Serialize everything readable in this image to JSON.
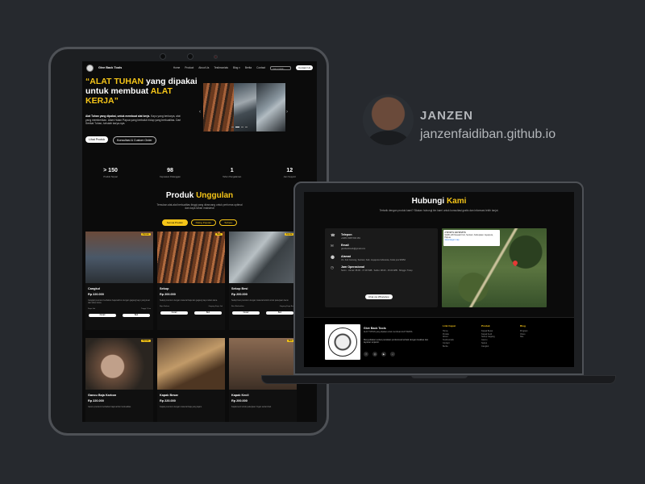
{
  "person": {
    "name": "JANZEN",
    "site": "janzenfaidiban.github.io"
  },
  "tablet": {
    "nav": {
      "brand": "Give Back Tools",
      "links": [
        "Home",
        "Product",
        "About Us",
        "Testimonials",
        "Blog ▾",
        "Berita",
        "Contact"
      ],
      "search_placeholder": "Cari produk...",
      "cta": "Contact Us"
    },
    "hero": {
      "q_open": "“",
      "w1": "ALAT TUHAN",
      "w2": " yang dipakai untuk membuat ",
      "w3": "ALAT KERJA",
      "q_close": "”",
      "desc_bold": "Alat Tuhan yang dipakai, untuk membuat alat kerja.",
      "desc_rest": " Kayu yang berkarya, alat yang memberikan. Alam Hutan Papua yang berbalut hidup yang berkualitas. Dari Seekat Tuhan, tahulah karya-nya.",
      "btn_primary": "Lihat Produk",
      "btn_secondary": "Konsultasi & Custom Order"
    },
    "stats": [
      {
        "value": "> 150",
        "label": "Produk Terjual"
      },
      {
        "value": "98",
        "label": "Kepuasan Pelanggan"
      },
      {
        "value": "1",
        "label": "Tahun Pengalaman"
      },
      {
        "value": "12",
        "label": "Jam Support"
      }
    ],
    "products_section": {
      "title_a": "Produk ",
      "title_b": "Unggulan",
      "subtitle": "Temukan alat-alat berkualitas tinggi yang dirancang untuk performa optimal dan daya tahan maksimal",
      "filters": [
        "Semua Produk",
        "Paling Populer",
        "Terbaru"
      ]
    },
    "products": [
      {
        "name": "Cangkul",
        "price": "Rp 220.000",
        "tag": "Populer",
        "desc": "Cangkul premium berbahan baja karbon dengan gagang kayu yang kuat dan tahan lama.",
        "spec_a": "Kayu Jati",
        "spec_b": "Tinggi 1,5 m",
        "btn_a": "Detail",
        "btn_b": "Beli"
      },
      {
        "name": "Sekop",
        "price": "Rp 200.000",
        "tag": "Baru",
        "desc": "Sekop premium dengan material baja dan gagang kayu tahan lama.",
        "spec_a": "Baja Karbon",
        "spec_b": "Gagang Kayu Jati",
        "btn_a": "Detail",
        "btn_b": "Beli"
      },
      {
        "name": "Sekop Besi",
        "price": "Rp 200.000",
        "tag": "Populer",
        "desc": "Sekop besi premium dengan material kokoh untuk pekerjaan berat.",
        "spec_a": "Besi Berkualitas",
        "spec_b": "Gagang Kayu Besi",
        "btn_a": "Detail",
        "btn_b": "Beli"
      },
      {
        "name": "Gancu Baja Karbon",
        "price": "Rp 220.000",
        "tag": "Populer",
        "desc": "Gancu premium berbahan baja karbon berkualitas.",
        "spec_a": "",
        "spec_b": "",
        "btn_a": "",
        "btn_b": ""
      },
      {
        "name": "Kapak Besar",
        "price": "Rp 220.000",
        "tag": "",
        "desc": "Kapak premium dengan material baja yang tajam.",
        "spec_a": "",
        "spec_b": "",
        "btn_a": "",
        "btn_b": ""
      },
      {
        "name": "Kapak Kecil",
        "price": "Rp 200.000",
        "tag": "Baru",
        "desc": "Kapak kecil untuk pekerjaan ringan sehari-hari.",
        "spec_a": "",
        "spec_b": "",
        "btn_a": "",
        "btn_b": ""
      }
    ]
  },
  "laptop": {
    "contact": {
      "title_a": "Hubungi ",
      "title_b": "Kami",
      "subtitle": "Tertarik dengan produk kami? Silakan hubungi tim kami untuk konsultasi gratis dan informasi lebih lanjut.",
      "items": [
        {
          "icon": "phone-icon",
          "glyph": "☎",
          "label": "Telepon",
          "value": "+6281 0305 549 181"
        },
        {
          "icon": "mail-icon",
          "glyph": "✉",
          "label": "Email",
          "value": "givebacktools@gmail.com"
        },
        {
          "icon": "location-icon",
          "glyph": "⬤",
          "label": "Alamat",
          "value": "Jln. Koti Gunung, Sentani, Kab. Jayapura Indonesia, Kode pos 99352"
        },
        {
          "icon": "clock-icon",
          "glyph": "◷",
          "label": "Jam Operasional",
          "value": "Senin - Jumat: 08.00 - 17.00 WIB · Sabtu: 08.00 - 15.00 WIB · Minggu: Tutup"
        }
      ],
      "whatsapp_button": "Chat via WhatsApp",
      "map_coords": "2°35'00\"S 140°30'25\"E",
      "map_addr": "9QRC+99 Nawadi Koti, Sentani, Kabupaten Jayapura, Papua",
      "map_link": "View larger map"
    },
    "footer": {
      "brand": "Give Back Tools",
      "tagline": "ALAT TUHAN yang dipakai untuk membuat ALAT KERJA",
      "desc": "Menyediakan solusi peralatan profesional terbaik dengan kualitas dan layanan terjamin.",
      "socials": [
        {
          "icon": "facebook-icon",
          "glyph": "f"
        },
        {
          "icon": "instagram-icon",
          "glyph": "◎"
        },
        {
          "icon": "youtube-icon",
          "glyph": "▶"
        },
        {
          "icon": "tiktok-icon",
          "glyph": "♪"
        }
      ],
      "columns": [
        {
          "heading": "Link Cepat",
          "links": [
            "Home",
            "Produk",
            "About",
            "Testimonials",
            "Contact",
            "Berita"
          ]
        },
        {
          "heading": "Produk",
          "links": [
            "Kapak Besar",
            "Kapak Kecil",
            "Sekop Gagang",
            "Gancu",
            "Sekop",
            "Cangkul"
          ]
        },
        {
          "heading": "Blog",
          "links": [
            "Program",
            "Video",
            "Site"
          ]
        }
      ]
    }
  },
  "colors": {
    "accent": "#f5c518",
    "background": "#26292e",
    "screen": "#0b0b0b"
  }
}
